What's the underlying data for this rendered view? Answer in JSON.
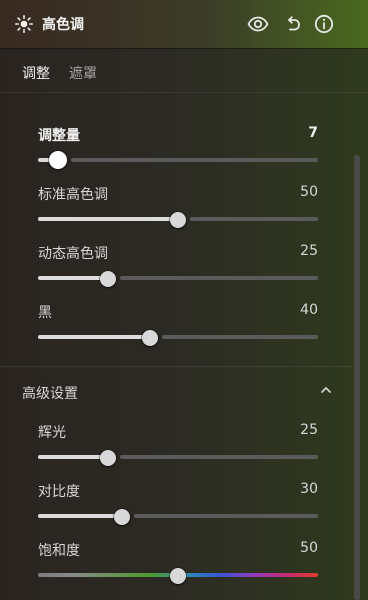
{
  "header": {
    "title": "高色调",
    "icons": {
      "left": "highlights-icon",
      "visibility": "eye-icon",
      "reset": "undo-icon",
      "info": "info-icon"
    },
    "colors": {
      "from": "#3a2a22",
      "to": "#4a6a1f"
    }
  },
  "tabs": [
    {
      "label": "调整",
      "active": true
    },
    {
      "label": "遮罩",
      "active": false
    }
  ],
  "controls": [
    {
      "label": "调整量",
      "value": "7",
      "level": 0.07
    },
    {
      "label": "标准高色调",
      "value": "50",
      "level": 0.5
    },
    {
      "label": "动态高色调",
      "value": "25",
      "level": 0.25
    },
    {
      "label": "黑",
      "value": "40",
      "level": 0.4
    }
  ],
  "advanced": {
    "title": "高级设置",
    "chevron_icon": "chevron-up-icon",
    "controls": [
      {
        "label": "辉光",
        "value": "25",
        "level": 0.25
      },
      {
        "label": "对比度",
        "value": "30",
        "level": 0.3
      },
      {
        "label": "饱和度",
        "value": "50",
        "level": 0.5
      }
    ]
  }
}
